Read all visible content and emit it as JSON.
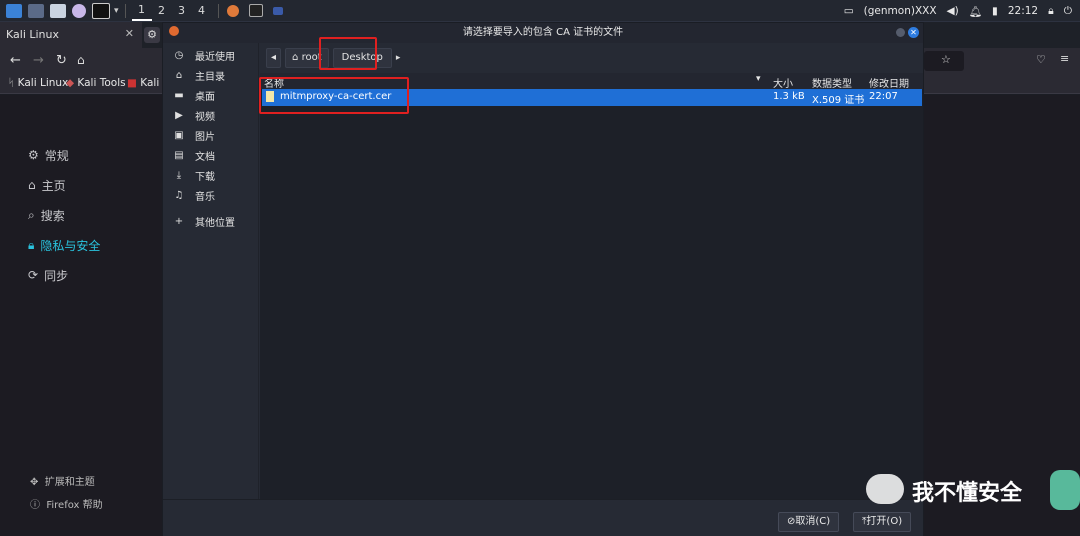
{
  "taskbar": {
    "workspaces": [
      "1",
      "2",
      "3",
      "4"
    ],
    "tray_user": "(genmon)XXX",
    "clock": "22:12"
  },
  "firefox": {
    "tab_title": "Kali Linux",
    "bookmarks": [
      "Kali Linux",
      "Kali Tools",
      "Kali D"
    ],
    "sidebar": [
      {
        "label": "常规",
        "icon": "gear-icon"
      },
      {
        "label": "主页",
        "icon": "home-icon"
      },
      {
        "label": "搜索",
        "icon": "search-icon"
      },
      {
        "label": "隐私与安全",
        "icon": "lock-icon"
      },
      {
        "label": "同步",
        "icon": "sync-icon"
      }
    ],
    "footer_links": [
      "扩展和主题",
      "Firefox 帮助"
    ]
  },
  "dialog": {
    "title": "请选择要导入的包含 CA 证书的文件",
    "places": [
      {
        "label": "最近使用",
        "icon": "clock-icon"
      },
      {
        "label": "主目录",
        "icon": "home-icon"
      },
      {
        "label": "桌面",
        "icon": "desktop-icon"
      },
      {
        "label": "视频",
        "icon": "video-icon"
      },
      {
        "label": "图片",
        "icon": "image-icon"
      },
      {
        "label": "文档",
        "icon": "document-icon"
      },
      {
        "label": "下载",
        "icon": "download-icon"
      },
      {
        "label": "音乐",
        "icon": "music-icon"
      },
      {
        "label": "其他位置",
        "icon": "plus-icon"
      }
    ],
    "path": [
      "root",
      "Desktop"
    ],
    "columns": {
      "name": "名称",
      "size": "大小",
      "type": "数据类型",
      "modified": "修改日期"
    },
    "files": [
      {
        "name": "mitmproxy-ca-cert.cer",
        "size": "1.3 kB",
        "type": "X.509 证书",
        "modified": "22:07"
      }
    ],
    "cancel_label": "取消(C)",
    "open_label": "打开(O)"
  },
  "watermark": "我不懂安全",
  "colors": {
    "selection": "#1f6fd6",
    "highlight_box": "#e02020",
    "active_link": "#2ac3de"
  }
}
